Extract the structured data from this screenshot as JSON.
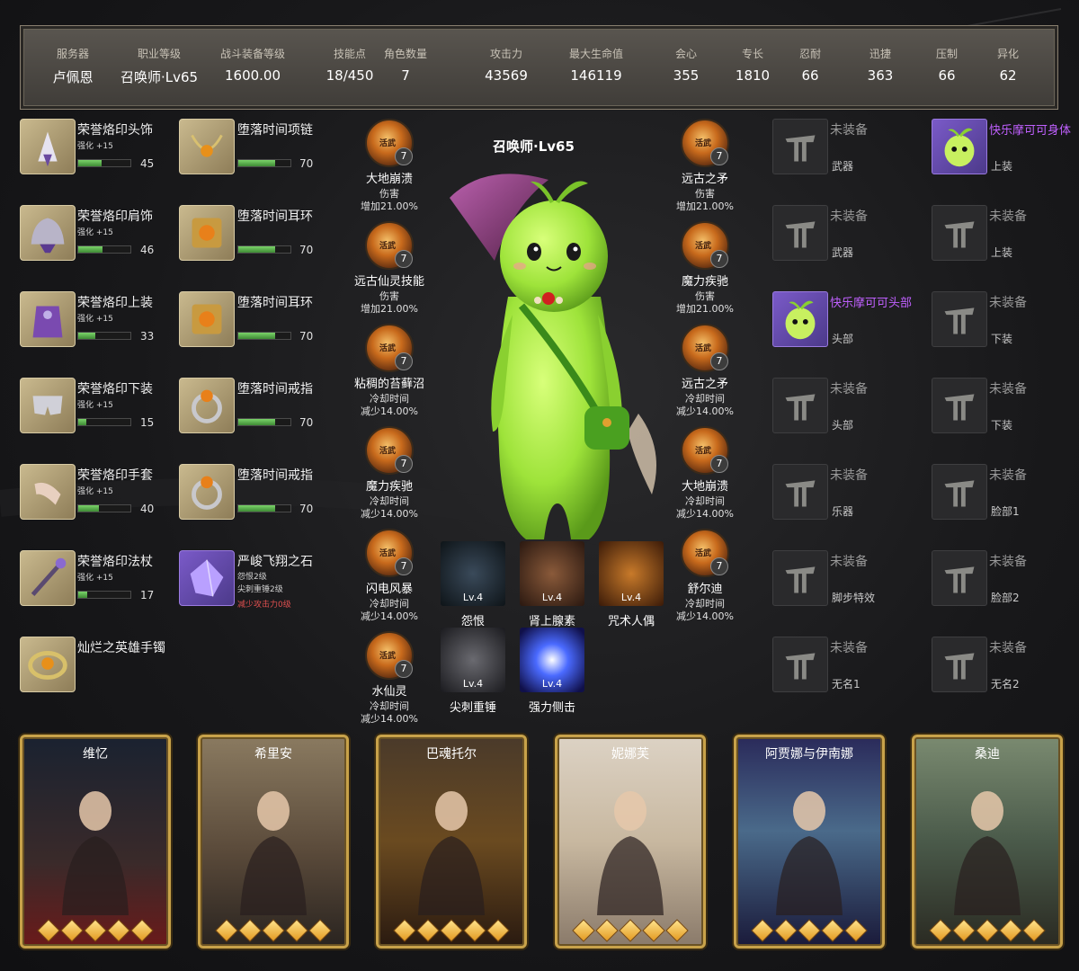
{
  "stats": [
    {
      "label": "服务器",
      "value": "卢佩恩"
    },
    {
      "label": "职业等级",
      "value": "召唤师·Lv65"
    },
    {
      "label": "战斗装备等级",
      "value": "1600.00"
    },
    {
      "label": "技能点",
      "value": "18/450"
    },
    {
      "label": "角色数量",
      "value": "7"
    },
    {
      "label": "攻击力",
      "value": "43569"
    },
    {
      "label": "最大生命值",
      "value": "146119"
    },
    {
      "label": "会心",
      "value": "355"
    },
    {
      "label": "专长",
      "value": "1810"
    },
    {
      "label": "忍耐",
      "value": "66"
    },
    {
      "label": "迅捷",
      "value": "363"
    },
    {
      "label": "压制",
      "value": "66"
    },
    {
      "label": "异化",
      "value": "62"
    }
  ],
  "character_label": "召唤师·Lv65",
  "equipment_left": [
    {
      "name": "荣誉烙印头饰",
      "strength": "强化 +15",
      "quality": 45,
      "icon": "headgear-icon"
    },
    {
      "name": "荣誉烙印肩饰",
      "strength": "强化 +15",
      "quality": 46,
      "icon": "shoulder-icon"
    },
    {
      "name": "荣誉烙印上装",
      "strength": "强化 +15",
      "quality": 33,
      "icon": "chest-icon"
    },
    {
      "name": "荣誉烙印下装",
      "strength": "强化 +15",
      "quality": 15,
      "icon": "pants-icon"
    },
    {
      "name": "荣誉烙印手套",
      "strength": "强化 +15",
      "quality": 40,
      "icon": "gloves-icon"
    },
    {
      "name": "荣誉烙印法杖",
      "strength": "强化 +15",
      "quality": 17,
      "icon": "staff-icon"
    },
    {
      "name": "灿烂之英雄手镯",
      "icon": "bracelet-icon"
    }
  ],
  "accessories": [
    {
      "name": "堕落时间项链",
      "quality": 70,
      "icon": "necklace-icon"
    },
    {
      "name": "堕落时间耳环",
      "quality": 70,
      "icon": "earring-icon"
    },
    {
      "name": "堕落时间耳环",
      "quality": 70,
      "icon": "earring-icon"
    },
    {
      "name": "堕落时间戒指",
      "quality": 70,
      "icon": "ring-icon"
    },
    {
      "name": "堕落时间戒指",
      "quality": 70,
      "icon": "ring-icon"
    }
  ],
  "ability_stone": {
    "name": "严峻飞翔之石",
    "lines": [
      "怨恨2级",
      "尖刺重锤2级"
    ],
    "negative": "减少攻击力0级",
    "icon": "ability-stone-icon"
  },
  "engravings_left": [
    {
      "name": "大地崩溃",
      "stat": "伤害",
      "effect": "增加21.00%",
      "level": "7",
      "tag": "活武"
    },
    {
      "name": "远古仙灵技能",
      "stat": "伤害",
      "effect": "增加21.00%",
      "level": "7",
      "tag": "活武"
    },
    {
      "name": "粘稠的苔藓沼",
      "stat": "冷却时间",
      "effect": "减少14.00%",
      "level": "7",
      "tag": "活武"
    },
    {
      "name": "魔力疾驰",
      "stat": "冷却时间",
      "effect": "减少14.00%",
      "level": "7",
      "tag": "活武"
    },
    {
      "name": "闪电风暴",
      "stat": "冷却时间",
      "effect": "减少14.00%",
      "level": "7",
      "tag": "活武"
    },
    {
      "name": "水仙灵",
      "stat": "冷却时间",
      "effect": "减少14.00%",
      "level": "7",
      "tag": "活武"
    }
  ],
  "engravings_right": [
    {
      "name": "远古之矛",
      "stat": "伤害",
      "effect": "增加21.00%",
      "level": "7",
      "tag": "活武"
    },
    {
      "name": "魔力疾驰",
      "stat": "伤害",
      "effect": "增加21.00%",
      "level": "7",
      "tag": "活武"
    },
    {
      "name": "远古之矛",
      "stat": "冷却时间",
      "effect": "减少14.00%",
      "level": "7",
      "tag": "活武"
    },
    {
      "name": "大地崩溃",
      "stat": "冷却时间",
      "effect": "减少14.00%",
      "level": "7",
      "tag": "活武"
    },
    {
      "name": "舒尔迪",
      "stat": "冷却时间",
      "effect": "减少14.00%",
      "level": "7",
      "tag": "活武"
    }
  ],
  "card_skills": [
    {
      "name": "怨恨",
      "level": "Lv.4",
      "icon": "grudge-icon"
    },
    {
      "name": "肾上腺素",
      "level": "Lv.4",
      "icon": "adrenaline-icon"
    },
    {
      "name": "咒术人偶",
      "level": "Lv.4",
      "icon": "cursed-doll-icon"
    },
    {
      "name": "尖刺重锤",
      "level": "Lv.4",
      "icon": "spike-hammer-icon"
    },
    {
      "name": "强力侧击",
      "level": "Lv.4",
      "icon": "hit-master-icon"
    }
  ],
  "avatar_left": [
    {
      "title": "未装备",
      "slot": "武器"
    },
    {
      "title": "未装备",
      "slot": "武器"
    },
    {
      "title": "快乐摩可可头部",
      "slot": "头部",
      "equipped": true
    },
    {
      "title": "未装备",
      "slot": "头部"
    },
    {
      "title": "未装备",
      "slot": "乐器"
    },
    {
      "title": "未装备",
      "slot": "脚步特效"
    },
    {
      "title": "未装备",
      "slot": "无名1"
    }
  ],
  "avatar_right": [
    {
      "title": "快乐摩可可身体",
      "slot": "上装",
      "equipped": true
    },
    {
      "title": "未装备",
      "slot": "上装"
    },
    {
      "title": "未装备",
      "slot": "下装"
    },
    {
      "title": "未装备",
      "slot": "下装"
    },
    {
      "title": "未装备",
      "slot": "脸部1"
    },
    {
      "title": "未装备",
      "slot": "脸部2"
    },
    {
      "title": "未装备",
      "slot": "无名2"
    }
  ],
  "cards": [
    {
      "name": "维忆",
      "awakening": 5
    },
    {
      "name": "希里安",
      "awakening": 5
    },
    {
      "name": "巴魂托尔",
      "awakening": 5
    },
    {
      "name": "妮娜芙",
      "awakening": 5
    },
    {
      "name": "阿贾娜与伊南娜",
      "awakening": 5
    },
    {
      "name": "桑迪",
      "awakening": 5
    }
  ],
  "colors": {
    "accent": "#c8a24a",
    "quality_bar": "#5bbf4c",
    "purple_text": "#c060ff",
    "negative": "#e05050"
  }
}
